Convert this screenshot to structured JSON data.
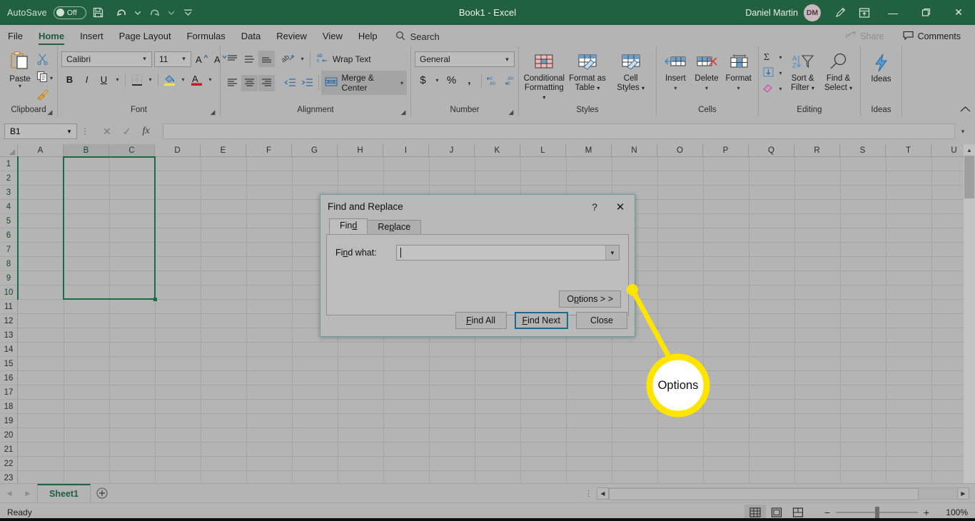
{
  "titlebar": {
    "autosave_label": "AutoSave",
    "autosave_state": "Off",
    "save_icon": "save-icon",
    "undo_icon": "undo-icon",
    "redo_icon": "redo-icon",
    "customize_icon": "customize-quick-access-icon",
    "document_title": "Book1  -  Excel",
    "user_name": "Daniel Martin",
    "user_initials": "DM",
    "ribbon_display_icon": "ribbon-display-options-icon",
    "pen_icon": "pen-icon",
    "minimize": "—",
    "restore": "❐",
    "close": "✕"
  },
  "tabs": [
    {
      "label": "File",
      "active": false
    },
    {
      "label": "Home",
      "active": true
    },
    {
      "label": "Insert",
      "active": false
    },
    {
      "label": "Page Layout",
      "active": false
    },
    {
      "label": "Formulas",
      "active": false
    },
    {
      "label": "Data",
      "active": false
    },
    {
      "label": "Review",
      "active": false
    },
    {
      "label": "View",
      "active": false
    },
    {
      "label": "Help",
      "active": false
    }
  ],
  "search": {
    "label": "Search",
    "icon": "search-icon"
  },
  "share": {
    "label": "Share",
    "icon": "share-icon"
  },
  "comments": {
    "label": "Comments",
    "icon": "comment-icon"
  },
  "ribbon": {
    "collapse_icon": "collapse-ribbon-icon",
    "clipboard": {
      "group_label": "Clipboard",
      "paste_label": "Paste",
      "cut_label": "Cut",
      "copy_label": "Copy",
      "format_painter_label": "Format Painter"
    },
    "font": {
      "group_label": "Font",
      "font_name": "Calibri",
      "font_size": "11",
      "grow_font": "A",
      "shrink_font": "A",
      "bold": "B",
      "italic": "I",
      "underline": "U",
      "borders_label": "Borders",
      "fill_color_label": "Fill Color",
      "font_color_label": "Font Color"
    },
    "alignment": {
      "group_label": "Alignment",
      "wrap_text_label": "Wrap Text",
      "merge_center_label": "Merge & Center",
      "orientation_label": "Orientation",
      "decrease_indent_label": "Decrease Indent",
      "increase_indent_label": "Increase Indent"
    },
    "number": {
      "group_label": "Number",
      "format": "General",
      "accounting": "$",
      "percent": "%",
      "comma": "‚",
      "increase_decimal_label": "Increase Decimal",
      "decrease_decimal_label": "Decrease Decimal"
    },
    "styles": {
      "group_label": "Styles",
      "conditional_formatting": "Conditional\nFormatting",
      "conditional_formatting_l1": "Conditional",
      "conditional_formatting_l2": "Formatting",
      "format_as_table_l1": "Format as",
      "format_as_table_l2": "Table",
      "cell_styles_l1": "Cell",
      "cell_styles_l2": "Styles"
    },
    "cells": {
      "group_label": "Cells",
      "insert": "Insert",
      "delete": "Delete",
      "format": "Format"
    },
    "editing": {
      "group_label": "Editing",
      "autosum_label": "AutoSum",
      "fill_label": "Fill",
      "clear_label": "Clear",
      "sort_filter_l1": "Sort &",
      "sort_filter_l2": "Filter",
      "find_select_l1": "Find &",
      "find_select_l2": "Select"
    },
    "ideas": {
      "group_label": "Ideas",
      "ideas_label": "Ideas"
    }
  },
  "formulabar": {
    "name_box": "B1",
    "cancel_icon": "cancel-icon",
    "enter_icon": "confirm-icon",
    "function_icon": "fx",
    "value": "",
    "expand_icon": "expand-formula-bar-icon"
  },
  "grid": {
    "columns": [
      "A",
      "B",
      "C",
      "D",
      "E",
      "F",
      "G",
      "H",
      "I",
      "J",
      "K",
      "L",
      "M",
      "N",
      "O",
      "P",
      "Q",
      "R",
      "S",
      "T",
      "U"
    ],
    "rows": [
      1,
      2,
      3,
      4,
      5,
      6,
      7,
      8,
      9,
      10,
      11,
      12,
      13,
      14,
      15,
      16,
      17,
      18,
      19,
      20,
      21,
      22,
      23
    ],
    "selected_columns": [
      "B",
      "C"
    ],
    "selected_range": "B1:C10",
    "selection_color": "#1d6b45"
  },
  "sheettabs": {
    "prev_icon": "previous-sheet-icon",
    "next_icon": "next-sheet-icon",
    "sheets": [
      "Sheet1"
    ],
    "add_sheet_icon": "add-sheet-icon"
  },
  "statusbar": {
    "status": "Ready",
    "view_normal": "normal-view-icon",
    "view_page_layout": "page-layout-view-icon",
    "view_page_break": "page-break-preview-icon",
    "zoom_out": "−",
    "zoom_in": "+",
    "zoom_level": "100%"
  },
  "dialog": {
    "title": "Find and Replace",
    "help_icon": "?",
    "close_icon": "✕",
    "tabs": [
      {
        "label": "Find",
        "accel": "d",
        "active": true
      },
      {
        "label": "Replace",
        "accel": "p",
        "active": false
      }
    ],
    "find_what_label": "Find what:",
    "find_what_value": "",
    "dropdown_icon": "chevron-down-icon",
    "options_button": "Options > >",
    "buttons": [
      {
        "label": "Find All",
        "default": false
      },
      {
        "label": "Find Next",
        "default": true
      },
      {
        "label": "Close",
        "default": false
      }
    ]
  },
  "callout": {
    "label": "Options",
    "color": "#ffe400",
    "target": "options-button"
  }
}
